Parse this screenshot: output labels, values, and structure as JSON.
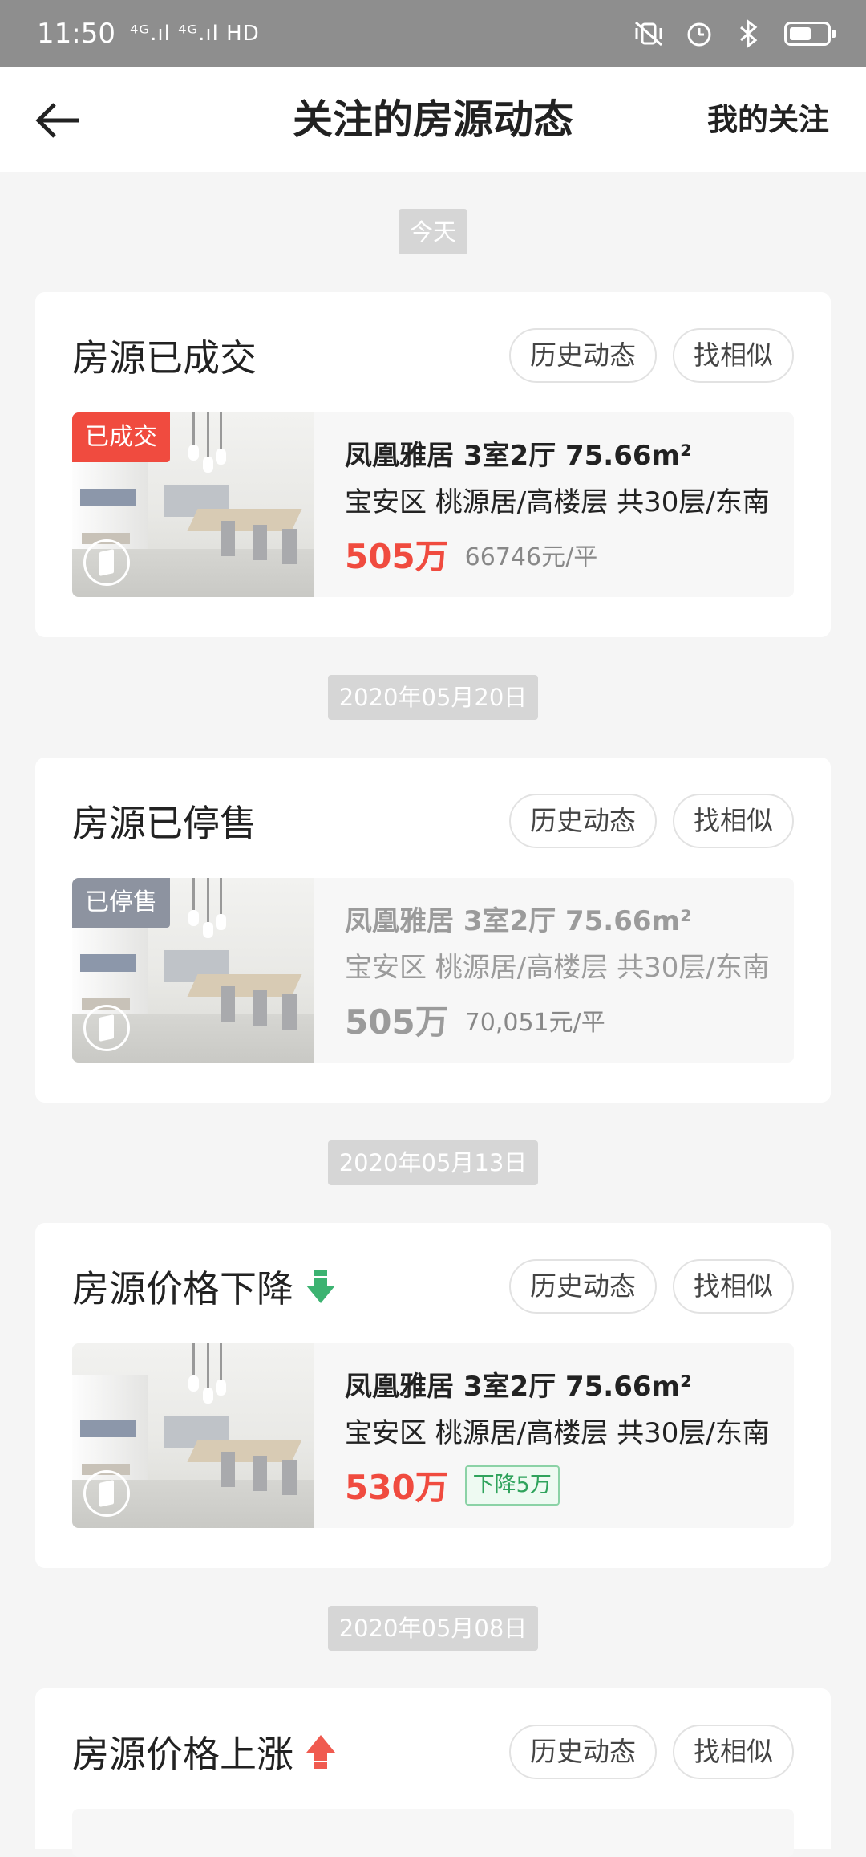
{
  "status_bar": {
    "time": "11:50",
    "signal": "⁴ᴳ.ıl ⁴ᴳ.ıl HD",
    "hd": ""
  },
  "header": {
    "title": "关注的房源动态",
    "right_action": "我的关注"
  },
  "feed": [
    {
      "date": "今天",
      "title": "房源已成交",
      "trend": "",
      "history_label": "历史动态",
      "similar_label": "找相似",
      "badge": "已成交",
      "badge_type": "sold",
      "name": "凤凰雅居 3室2厅 75.66m²",
      "address": "宝安区 桃源居/高楼层 共30层/东南",
      "price": "505万",
      "unit_price": "66746元/平",
      "change": "",
      "muted": false
    },
    {
      "date": "2020年05月20日",
      "title": "房源已停售",
      "trend": "",
      "history_label": "历史动态",
      "similar_label": "找相似",
      "badge": "已停售",
      "badge_type": "stopped",
      "name": "凤凰雅居 3室2厅 75.66m²",
      "address": "宝安区 桃源居/高楼层 共30层/东南",
      "price": "505万",
      "unit_price": "70,051元/平",
      "change": "",
      "muted": true
    },
    {
      "date": "2020年05月13日",
      "title": "房源价格下降",
      "trend": "down",
      "history_label": "历史动态",
      "similar_label": "找相似",
      "badge": "",
      "badge_type": "",
      "name": "凤凰雅居 3室2厅 75.66m²",
      "address": "宝安区 桃源居/高楼层 共30层/东南",
      "price": "530万",
      "unit_price": "",
      "change": "下降5万",
      "muted": false
    },
    {
      "date": "2020年05月08日",
      "title": "房源价格上涨",
      "trend": "up",
      "history_label": "历史动态",
      "similar_label": "找相似"
    }
  ],
  "colors": {
    "accent_red": "#f04b3f",
    "down_green": "#2fa35c",
    "up_red": "#f05a4f",
    "stopped_gray": "#8d93a0"
  },
  "icons": {
    "back": "arrow-left-icon",
    "vr": "vr-360-icon",
    "down": "arrow-down-icon",
    "up": "arrow-up-icon"
  }
}
